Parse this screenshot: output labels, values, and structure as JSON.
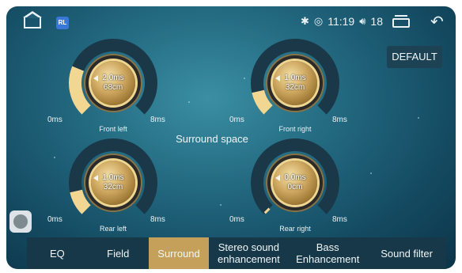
{
  "status_bar": {
    "bluetooth_icon": "bluetooth-icon",
    "signal_icon": "signal-icon",
    "time": "11:19",
    "volume_icon": "volume-icon",
    "volume_level": "18",
    "app_badge": "RL"
  },
  "default_button": "DEFAULT",
  "surround_title": "Surround space",
  "knobs": [
    {
      "label": "Front left",
      "delay_ms": "2.0ms",
      "distance_cm": "68cm",
      "min": "0ms",
      "max": "8ms",
      "level": 0.25
    },
    {
      "label": "Front right",
      "delay_ms": "1.0ms",
      "distance_cm": "32cm",
      "min": "0ms",
      "max": "8ms",
      "level": 0.12
    },
    {
      "label": "Rear left",
      "delay_ms": "1.0ms",
      "distance_cm": "32cm",
      "min": "0ms",
      "max": "8ms",
      "level": 0.12
    },
    {
      "label": "Rear right",
      "delay_ms": "0.0ms",
      "distance_cm": "0cm",
      "min": "0ms",
      "max": "8ms",
      "level": 0.0
    }
  ],
  "tabs": [
    {
      "label": "EQ",
      "active": false
    },
    {
      "label": "Field",
      "active": false
    },
    {
      "label": "Surround",
      "active": true
    },
    {
      "label": "Stereo sound enhancement",
      "active": false
    },
    {
      "label": "Bass Enhancement",
      "active": false
    },
    {
      "label": "Sound filter",
      "active": false
    }
  ],
  "colors": {
    "accent": "#c5a05a",
    "arc_fill": "#f1d792",
    "arc_track": "#1a3848"
  }
}
